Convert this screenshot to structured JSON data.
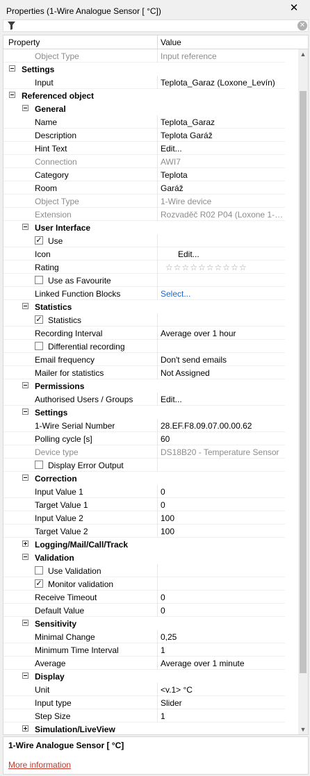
{
  "window": {
    "title": "Properties (1-Wire Analogue Sensor [ °C])",
    "close_icon": "close-icon"
  },
  "filter": {
    "icon": "funnel-icon",
    "placeholder": "",
    "clear_icon": "clear-icon"
  },
  "grid": {
    "header": {
      "property": "Property",
      "value": "Value"
    },
    "rows": [
      {
        "k": "object-type-top",
        "name": "Object Type",
        "value": "Input reference",
        "indent": 1,
        "grey": true
      },
      {
        "k": "cat-settings",
        "name": "Settings",
        "indent": 0,
        "cat": true,
        "toggle": "minus"
      },
      {
        "k": "input",
        "name": "Input",
        "value": "Teplota_Garaz (Loxone_Levín)",
        "indent": 1
      },
      {
        "k": "cat-referenced-object",
        "name": "Referenced object",
        "indent": 0,
        "cat": true,
        "toggle": "minus"
      },
      {
        "k": "cat-general",
        "name": "General",
        "indent": 1,
        "cat": true,
        "toggle": "minus"
      },
      {
        "k": "name",
        "name": "Name",
        "value": "Teplota_Garaz",
        "indent": 2
      },
      {
        "k": "description",
        "name": "Description",
        "value": "Teplota Garáž",
        "indent": 2
      },
      {
        "k": "hint-text",
        "name": "Hint Text",
        "value": "Edit...",
        "indent": 2
      },
      {
        "k": "connection",
        "name": "Connection",
        "value": "AWI7",
        "indent": 2,
        "grey": true
      },
      {
        "k": "category",
        "name": "Category",
        "value": "Teplota",
        "indent": 2
      },
      {
        "k": "room",
        "name": "Room",
        "value": "Garáž",
        "indent": 2
      },
      {
        "k": "object-type",
        "name": "Object Type",
        "value": "1-Wire device",
        "indent": 2,
        "grey": true
      },
      {
        "k": "extension",
        "name": "Extension",
        "value": "Rozvaděč R02 P04 (Loxone 1-W...",
        "indent": 2,
        "grey": true
      },
      {
        "k": "cat-user-interface",
        "name": "User Interface",
        "indent": 1,
        "cat": true,
        "toggle": "minus"
      },
      {
        "k": "use",
        "name": "Use",
        "indent": 2,
        "check": true,
        "checked": true
      },
      {
        "k": "icon",
        "name": "Icon",
        "value": "Edit...",
        "indent": 2,
        "valoffset": true
      },
      {
        "k": "rating",
        "name": "Rating",
        "indent": 2,
        "stars": true
      },
      {
        "k": "use-as-favourite",
        "name": "Use as Favourite",
        "indent": 2,
        "check": true,
        "checked": false
      },
      {
        "k": "linked-function-blocks",
        "name": "Linked Function Blocks",
        "value": "Select...",
        "indent": 2,
        "link": true
      },
      {
        "k": "cat-statistics",
        "name": "Statistics",
        "indent": 1,
        "cat": true,
        "toggle": "minus"
      },
      {
        "k": "statistics",
        "name": "Statistics",
        "indent": 2,
        "check": true,
        "checked": true
      },
      {
        "k": "recording-interval",
        "name": "Recording Interval",
        "value": "Average over 1 hour",
        "indent": 2
      },
      {
        "k": "differential-recording",
        "name": "Differential recording",
        "indent": 2,
        "check": true,
        "checked": false
      },
      {
        "k": "email-frequency",
        "name": "Email frequency",
        "value": "Don't send emails",
        "indent": 2
      },
      {
        "k": "mailer-for-statistics",
        "name": "Mailer for statistics",
        "value": "Not Assigned",
        "indent": 2
      },
      {
        "k": "cat-permissions",
        "name": "Permissions",
        "indent": 1,
        "cat": true,
        "toggle": "minus"
      },
      {
        "k": "authorised-users",
        "name": "Authorised Users / Groups",
        "value": "Edit...",
        "indent": 2
      },
      {
        "k": "cat-settings-2",
        "name": "Settings",
        "indent": 1,
        "cat": true,
        "toggle": "minus"
      },
      {
        "k": "serial-number",
        "name": "1-Wire Serial Number",
        "value": "28.EF.F8.09.07.00.00.62",
        "indent": 2
      },
      {
        "k": "polling-cycle",
        "name": "Polling cycle [s]",
        "value": "60",
        "indent": 2
      },
      {
        "k": "device-type",
        "name": "Device type",
        "value": "DS18B20 - Temperature Sensor",
        "indent": 2,
        "grey": true
      },
      {
        "k": "display-error-output",
        "name": "Display Error Output",
        "indent": 2,
        "check": true,
        "checked": false
      },
      {
        "k": "cat-correction",
        "name": "Correction",
        "indent": 1,
        "cat": true,
        "toggle": "minus"
      },
      {
        "k": "input-value-1",
        "name": "Input Value 1",
        "value": "0",
        "indent": 2
      },
      {
        "k": "target-value-1",
        "name": "Target Value 1",
        "value": "0",
        "indent": 2
      },
      {
        "k": "input-value-2",
        "name": "Input Value 2",
        "value": "100",
        "indent": 2
      },
      {
        "k": "target-value-2",
        "name": "Target Value 2",
        "value": "100",
        "indent": 2
      },
      {
        "k": "cat-logging",
        "name": "Logging/Mail/Call/Track",
        "indent": 1,
        "cat": true,
        "toggle": "plus"
      },
      {
        "k": "cat-validation",
        "name": "Validation",
        "indent": 1,
        "cat": true,
        "toggle": "minus"
      },
      {
        "k": "use-validation",
        "name": "Use Validation",
        "indent": 2,
        "check": true,
        "checked": false
      },
      {
        "k": "monitor-validation",
        "name": "Monitor validation",
        "indent": 2,
        "check": true,
        "checked": true
      },
      {
        "k": "receive-timeout",
        "name": "Receive Timeout",
        "value": "0",
        "indent": 2
      },
      {
        "k": "default-value",
        "name": "Default Value",
        "value": "0",
        "indent": 2
      },
      {
        "k": "cat-sensitivity",
        "name": "Sensitivity",
        "indent": 1,
        "cat": true,
        "toggle": "minus"
      },
      {
        "k": "minimal-change",
        "name": "Minimal Change",
        "value": "0,25",
        "indent": 2
      },
      {
        "k": "minimum-time-interval",
        "name": "Minimum Time Interval",
        "value": "1",
        "indent": 2
      },
      {
        "k": "average",
        "name": "Average",
        "value": "Average over 1 minute",
        "indent": 2
      },
      {
        "k": "cat-display",
        "name": "Display",
        "indent": 1,
        "cat": true,
        "toggle": "minus"
      },
      {
        "k": "unit",
        "name": "Unit",
        "value": "<v.1> °C",
        "indent": 2
      },
      {
        "k": "input-type",
        "name": "Input type",
        "value": "Slider",
        "indent": 2
      },
      {
        "k": "step-size",
        "name": "Step Size",
        "value": "1",
        "indent": 2
      },
      {
        "k": "cat-simulation",
        "name": "Simulation/LiveView",
        "indent": 1,
        "cat": true,
        "toggle": "plus"
      }
    ],
    "rating": {
      "stars": 10,
      "filled": 0
    }
  },
  "help": {
    "title": "1-Wire Analogue Sensor [ °C]",
    "link": "More information"
  }
}
